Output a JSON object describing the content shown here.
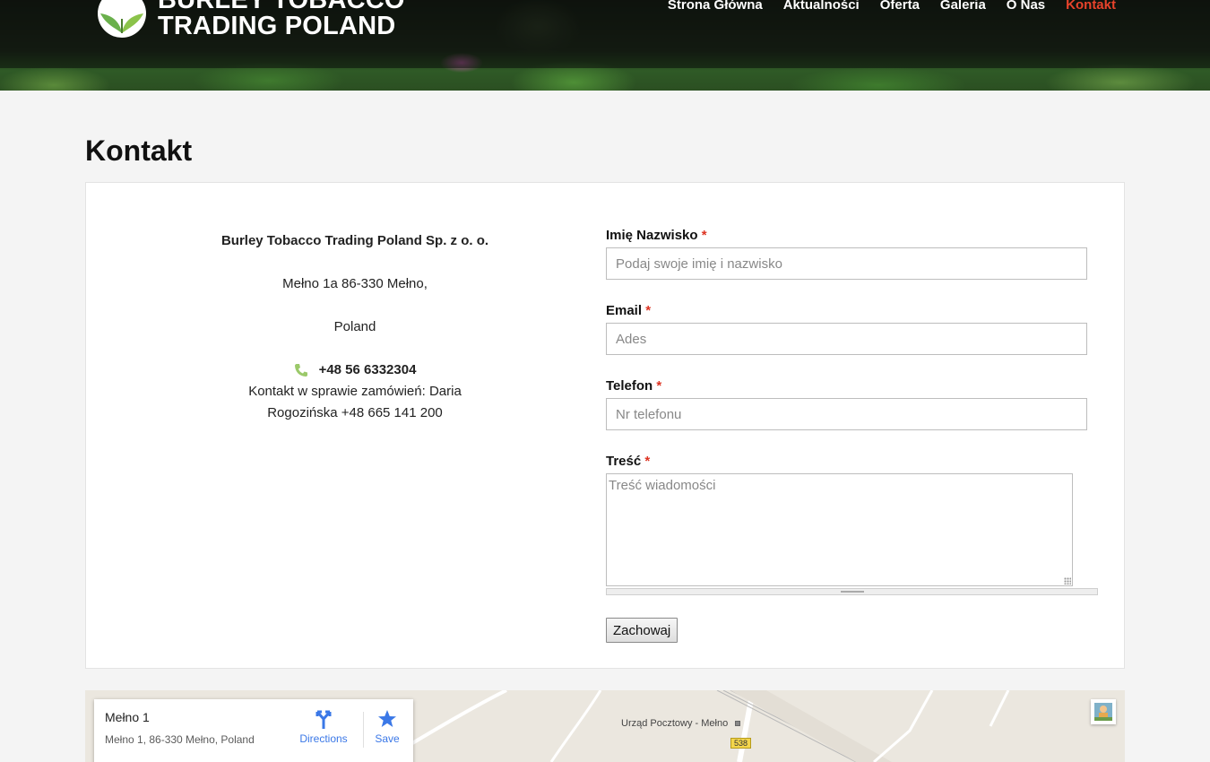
{
  "header": {
    "logo_line1": "BURLEY TOBACCO",
    "logo_line2": "TRADING POLAND",
    "nav": [
      {
        "label": "Strona Główna",
        "active": false
      },
      {
        "label": "Aktualności",
        "active": false
      },
      {
        "label": "Oferta",
        "active": false
      },
      {
        "label": "Galeria",
        "active": false
      },
      {
        "label": "O Nas",
        "active": false
      },
      {
        "label": "Kontakt",
        "active": true
      }
    ],
    "active_color": "#e8432b"
  },
  "page": {
    "title": "Kontakt"
  },
  "info": {
    "company": "Burley Tobacco Trading Poland Sp. z o. o.",
    "address": "Mełno 1a 86-330 Mełno,",
    "country": "Poland",
    "phone": "+48 56 6332304",
    "note_line1": "Kontakt w sprawie zamówień: Daria",
    "note_line2": "Rogozińska +48 665 141 200",
    "icon": "phone-icon"
  },
  "form": {
    "name_label": "Imię Nazwisko",
    "name_placeholder": "Podaj swoje imię i nazwisko",
    "email_label": "Email",
    "email_placeholder": "Ades",
    "phone_label": "Telefon",
    "phone_placeholder": "Nr telefonu",
    "message_label": "Treść",
    "message_placeholder": "Treść wiadomości",
    "required_mark": "*",
    "submit_label": "Zachowaj"
  },
  "map": {
    "place_title": "Mełno 1",
    "place_address": "Mełno 1, 86-330 Mełno, Poland",
    "directions_label": "Directions",
    "save_label": "Save",
    "poi_label": "Urząd Pocztowy - Mełno",
    "road_number": "538"
  }
}
